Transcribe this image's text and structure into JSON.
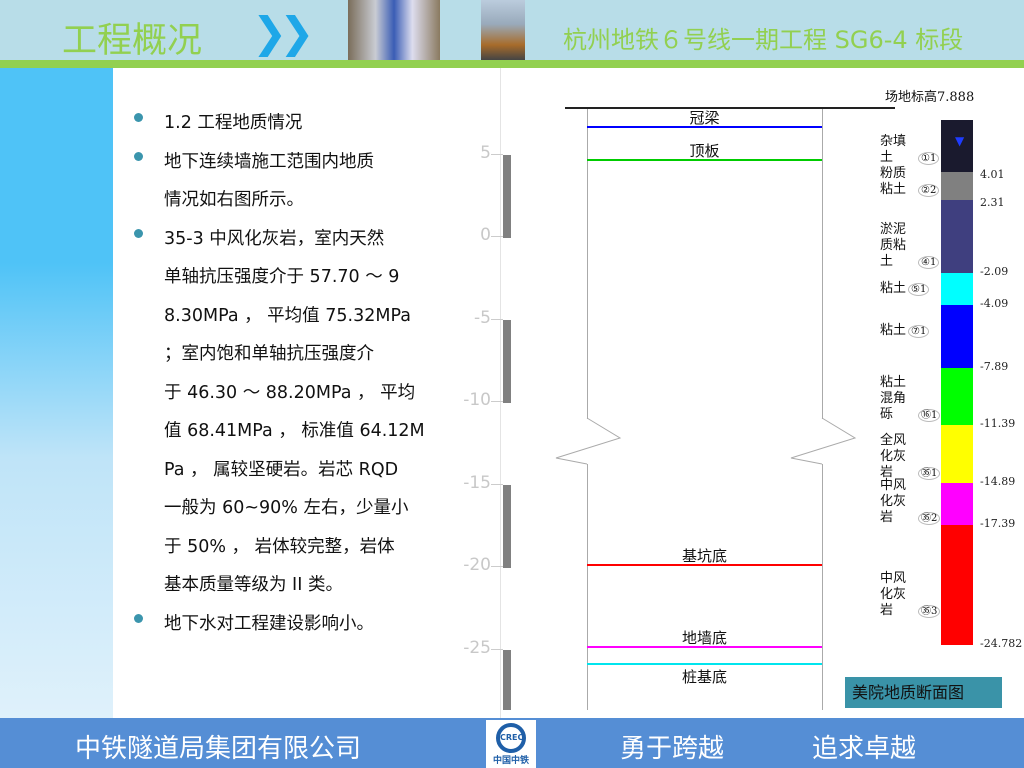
{
  "header": {
    "title": "工程概况",
    "chevron": "»",
    "project": "杭州地铁６号线一期工程 SG6-4 标段"
  },
  "content": {
    "bullets": [
      {
        "lines": [
          "1.2 工程地质情况"
        ]
      },
      {
        "lines": [
          "地下连续墙施工范围内地质",
          "情况如右图所示。"
        ]
      },
      {
        "lines": [
          "35-3 中风化灰岩，室内天然",
          "单轴抗压强度介于 57.70 ～ 9",
          "8.30MPa ， 平均值 75.32MPa",
          "；室内饱和单轴抗压强度介",
          "于 46.30 ～ 88.20MPa ， 平均",
          "值 68.41MPa ， 标准值 64.12M",
          "Pa ， 属较坚硬岩。岩芯 RQD",
          "一般为 60~90% 左右，少量小",
          "于 50% ， 岩体较完整，岩体",
          "基本质量等级为 II 类。"
        ]
      },
      {
        "lines": [
          "地下水对工程建设影响小。"
        ]
      }
    ]
  },
  "diagram": {
    "ground_label": "场地标高7.888",
    "ground_elevation": 7.888,
    "axis_ticks": [
      "5",
      "0",
      "-5",
      "-10",
      "-15",
      "-20",
      "-25"
    ],
    "levels": [
      {
        "label": "冠梁",
        "elevation": 6.7,
        "color": "#0000ff"
      },
      {
        "label": "顶板",
        "elevation": 4.7,
        "color": "#00cc00"
      },
      {
        "label": "基坑底",
        "elevation": -19.8,
        "color": "#ff0000"
      },
      {
        "label": "地墙底",
        "elevation": -24.8,
        "color": "#ff00ff"
      },
      {
        "label": "桩基底",
        "elevation": -25.8,
        "color": "#00e5ee"
      }
    ],
    "strata": [
      {
        "name": "杂填土",
        "code": "①1",
        "color": "#1a1a2e",
        "bottom": "4.01"
      },
      {
        "name": "粉质粘土",
        "code": "②2",
        "color": "#808080",
        "bottom": "2.31"
      },
      {
        "name": "淤泥质粘土",
        "code": "④1",
        "color": "#3f3f7f",
        "bottom": "-2.09"
      },
      {
        "name": "粘土",
        "code": "⑤1",
        "color": "#00ffff",
        "bottom": "-4.09"
      },
      {
        "name": "粘土",
        "code": "⑦1",
        "color": "#0000ff",
        "bottom": "-7.89"
      },
      {
        "name": "粘土混角砾",
        "code": "⑯1",
        "color": "#00ff00",
        "bottom": "-11.39"
      },
      {
        "name": "全风化灰岩",
        "code": "㉟1",
        "color": "#ffff00",
        "bottom": "-14.89"
      },
      {
        "name": "中风化灰岩",
        "code": "㉟2",
        "color": "#ff00ff",
        "bottom": "-17.39"
      },
      {
        "name": "中风化灰岩",
        "code": "㉟3",
        "color": "#ff0000",
        "bottom": "-24.782"
      }
    ],
    "caption": "美院地质断面图"
  },
  "footer": {
    "company": "中铁隧道局集团有限公司",
    "logo_text": "中国中铁",
    "logo_mark": "CREC",
    "slogan1": "勇于跨越",
    "slogan2": "追求卓越"
  }
}
